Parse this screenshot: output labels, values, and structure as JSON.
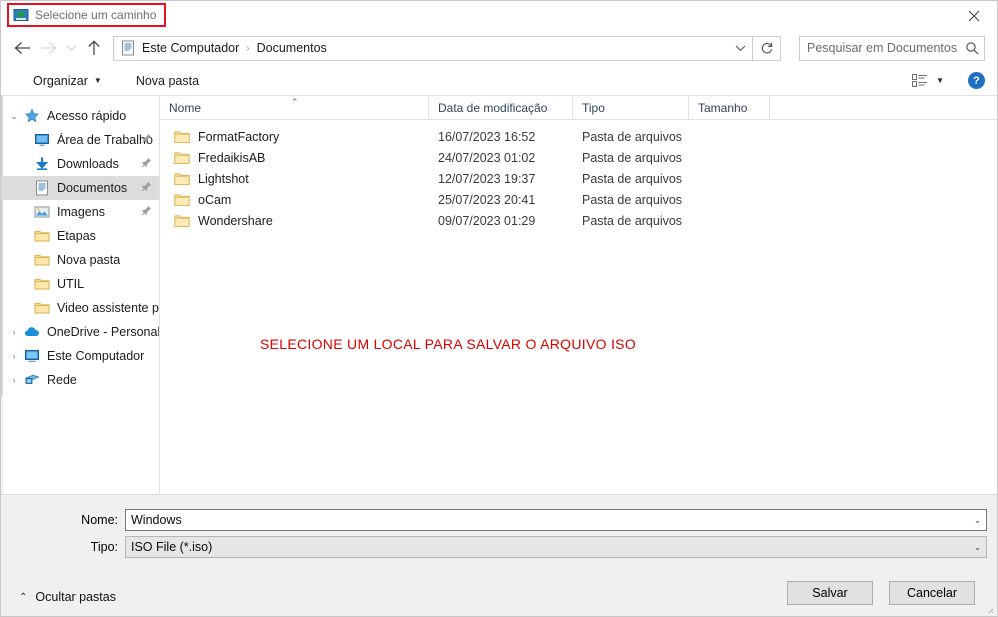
{
  "window": {
    "title": "Selecione um caminho",
    "title_icon": "save-download-icon",
    "close_label": "✕",
    "highlight_color": "#e81123"
  },
  "nav": {
    "back_icon": "arrow-left-icon",
    "forward_icon": "arrow-right-icon",
    "recent_icon": "chevron-down-icon",
    "up_icon": "arrow-up-icon",
    "breadcrumb_icon": "documents-icon",
    "breadcrumbs": [
      "Este Computador",
      "Documentos"
    ],
    "separator": "›",
    "dropdown_icon": "chevron-down-icon",
    "refresh_icon": "refresh-icon"
  },
  "search": {
    "placeholder": "Pesquisar em Documentos",
    "value": "",
    "icon": "search-icon"
  },
  "toolbar": {
    "organize_label": "Organizar",
    "organize_caret": "▼",
    "new_folder_label": "Nova pasta",
    "view_icon": "list-view-icon",
    "view_caret": "▼",
    "help_label": "?",
    "help_color": "#1f6fc4"
  },
  "sidebar": {
    "items": [
      {
        "label": "Acesso rápido",
        "icon": "star-icon",
        "chevron": "⌄",
        "indent": 0,
        "pinned": false,
        "selected": false
      },
      {
        "label": "Área de Trabalho",
        "icon": "desktop-icon",
        "chevron": "",
        "indent": 1,
        "pinned": true,
        "selected": false
      },
      {
        "label": "Downloads",
        "icon": "downloads-icon",
        "chevron": "",
        "indent": 1,
        "pinned": true,
        "selected": false
      },
      {
        "label": "Documentos",
        "icon": "documents-icon",
        "chevron": "",
        "indent": 1,
        "pinned": true,
        "selected": true
      },
      {
        "label": "Imagens",
        "icon": "pictures-icon",
        "chevron": "",
        "indent": 1,
        "pinned": true,
        "selected": false
      },
      {
        "label": "Etapas",
        "icon": "folder-icon",
        "chevron": "",
        "indent": 1,
        "pinned": false,
        "selected": false
      },
      {
        "label": "Nova pasta",
        "icon": "folder-icon",
        "chevron": "",
        "indent": 1,
        "pinned": false,
        "selected": false
      },
      {
        "label": "UTIL",
        "icon": "folder-icon",
        "chevron": "",
        "indent": 1,
        "pinned": false,
        "selected": false
      },
      {
        "label": "Video assistente pin",
        "icon": "folder-icon",
        "chevron": "",
        "indent": 1,
        "pinned": false,
        "selected": false
      },
      {
        "label": "OneDrive - Personal",
        "icon": "onedrive-cloud-icon",
        "chevron": "›",
        "indent": 0,
        "pinned": false,
        "selected": false
      },
      {
        "label": "Este Computador",
        "icon": "this-pc-icon",
        "chevron": "›",
        "indent": 0,
        "pinned": false,
        "selected": false
      },
      {
        "label": "Rede",
        "icon": "network-icon",
        "chevron": "›",
        "indent": 0,
        "pinned": false,
        "selected": false
      }
    ],
    "pin_glyph": "📌"
  },
  "filelist": {
    "columns": [
      "Nome",
      "Data de modificação",
      "Tipo",
      "Tamanho"
    ],
    "sort_column": "Nome",
    "sort_caret": "⌃",
    "rows": [
      {
        "name": "FormatFactory",
        "modified": "16/07/2023 16:52",
        "type": "Pasta de arquivos",
        "size": ""
      },
      {
        "name": "FredaikisAB",
        "modified": "24/07/2023 01:02",
        "type": "Pasta de arquivos",
        "size": ""
      },
      {
        "name": "Lightshot",
        "modified": "12/07/2023 19:37",
        "type": "Pasta de arquivos",
        "size": ""
      },
      {
        "name": "oCam",
        "modified": "25/07/2023 20:41",
        "type": "Pasta de arquivos",
        "size": ""
      },
      {
        "name": "Wondershare",
        "modified": "09/07/2023 01:29",
        "type": "Pasta de arquivos",
        "size": ""
      }
    ]
  },
  "annotation": {
    "text": "SELECIONE UM LOCAL PARA SALVAR O ARQUIVO ISO",
    "color": "#dd0000"
  },
  "footer": {
    "name_label": "Nome:",
    "name_value": "Windows",
    "type_label": "Tipo:",
    "type_value": "ISO File (*.iso)",
    "dropdown_caret": "⌄",
    "hide_folders_label": "Ocultar pastas",
    "hide_folders_caret": "⌃",
    "save_label": "Salvar",
    "cancel_label": "Cancelar"
  }
}
